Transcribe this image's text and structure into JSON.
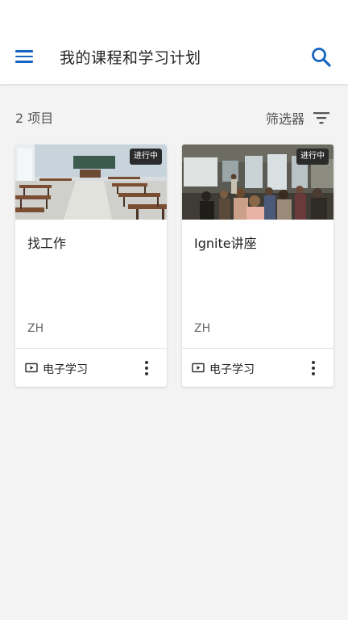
{
  "header": {
    "title": "我的课程和学习计划",
    "menu_icon": "hamburger-menu-icon",
    "search_icon": "search-icon",
    "accent_color": "#1565c0"
  },
  "toolbar": {
    "count_text": "2 项目",
    "filter_label": "筛选器",
    "filter_icon": "filter-icon"
  },
  "courses": [
    {
      "title": "找工作",
      "badge": "进行中",
      "language": "ZH",
      "type_label": "电子学习",
      "type_icon": "video-icon",
      "thumbnail": "classroom-image",
      "more_icon": "more-vertical-icon"
    },
    {
      "title": "Ignite讲座",
      "badge": "进行中",
      "language": "ZH",
      "type_label": "电子学习",
      "type_icon": "video-icon",
      "thumbnail": "lecture-audience-image",
      "more_icon": "more-vertical-icon"
    }
  ]
}
